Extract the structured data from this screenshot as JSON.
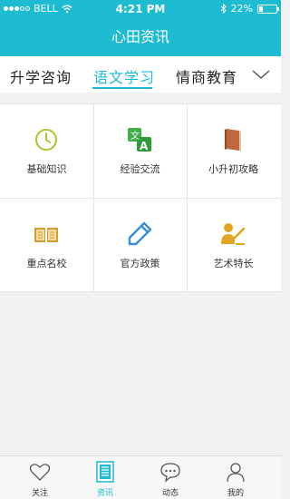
{
  "status": {
    "carrier": "BELL",
    "time": "4:21 PM",
    "battery": "22%",
    "battery_level": 0.22
  },
  "header": {
    "title": "心田资讯"
  },
  "tabs": [
    {
      "label": "升学咨询",
      "active": false
    },
    {
      "label": "语文学习",
      "active": true
    },
    {
      "label": "情商教育",
      "active": false
    }
  ],
  "grid": [
    {
      "label": "基础知识",
      "icon": "clock-icon"
    },
    {
      "label": "经验交流",
      "icon": "translate-icon"
    },
    {
      "label": "小升初攻略",
      "icon": "book-icon"
    },
    {
      "label": "重点名校",
      "icon": "open-book-icon"
    },
    {
      "label": "官方政策",
      "icon": "pencil-icon"
    },
    {
      "label": "艺术特长",
      "icon": "artist-icon"
    }
  ],
  "bottom_nav": [
    {
      "label": "关注",
      "icon": "heart-icon",
      "active": false
    },
    {
      "label": "资讯",
      "icon": "news-icon",
      "active": true
    },
    {
      "label": "动态",
      "icon": "chat-icon",
      "active": false
    },
    {
      "label": "我的",
      "icon": "person-icon",
      "active": false
    }
  ],
  "colors": {
    "accent": "#1dbcd3",
    "clock": "#a9c531",
    "translate": "#3fae49",
    "book": "#c0693f",
    "open_book": "#d69a2d",
    "pencil": "#3b8fd3",
    "artist": "#e2a722"
  }
}
